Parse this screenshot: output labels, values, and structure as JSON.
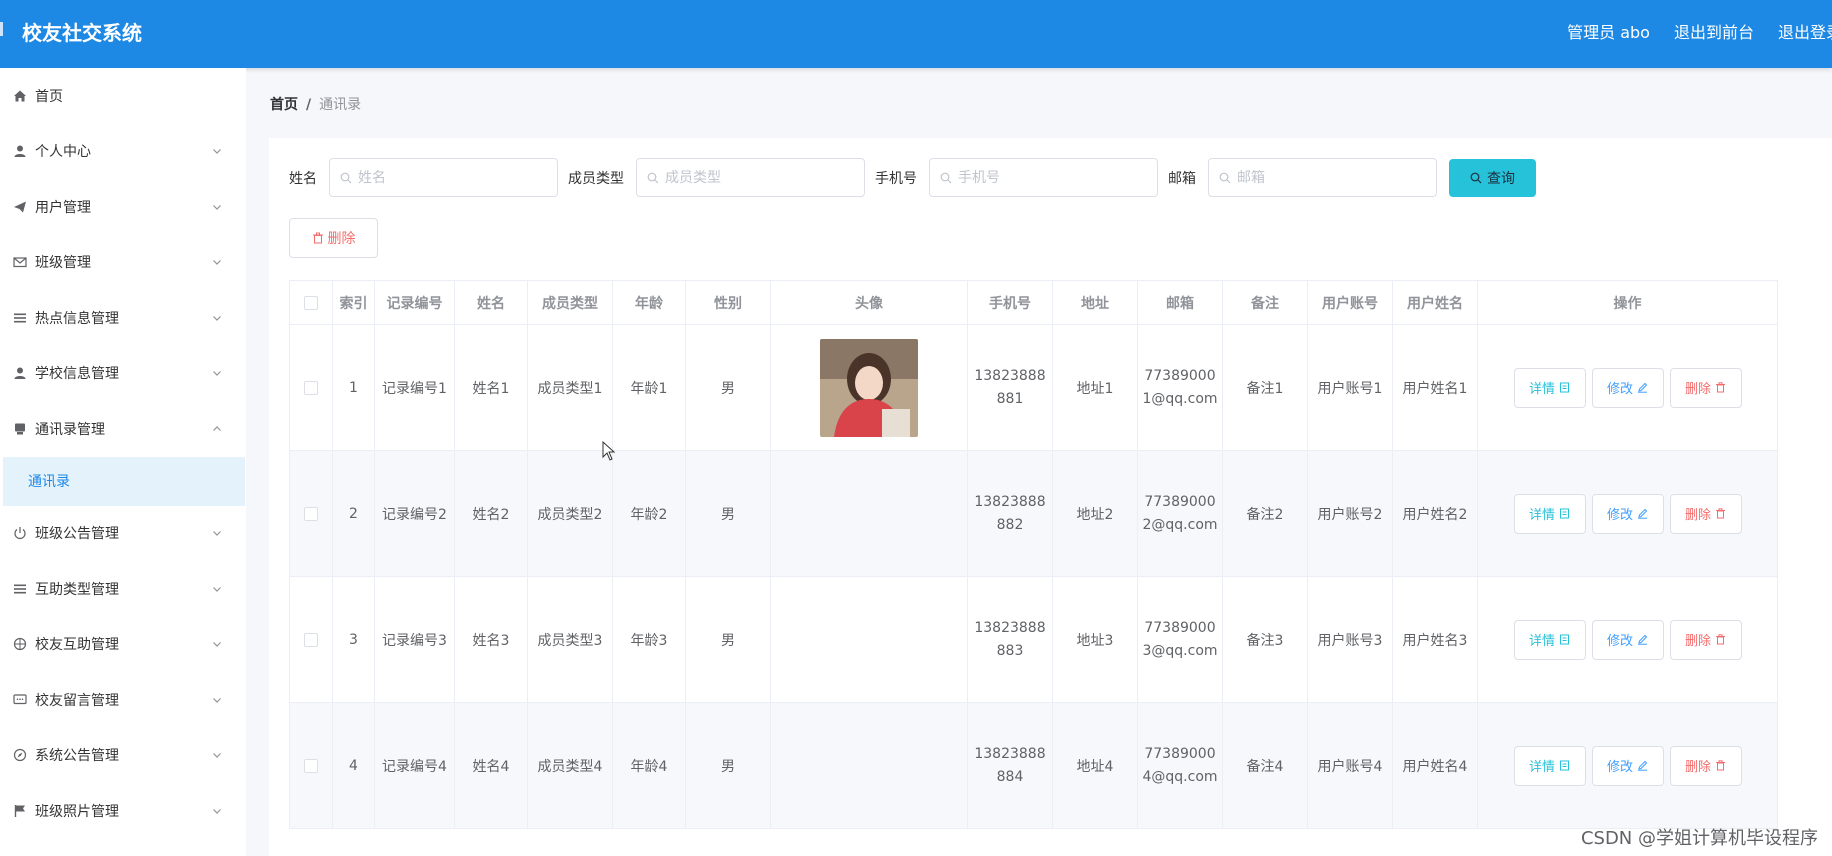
{
  "header": {
    "title": "校友社交系统",
    "user_label": "管理员 abo",
    "front_label": "退出到前台",
    "logout_label": "退出登录"
  },
  "sidebar": {
    "items": [
      {
        "label": "首页",
        "icon": "home-icon",
        "expandable": false
      },
      {
        "label": "个人中心",
        "icon": "user-icon",
        "expandable": true
      },
      {
        "label": "用户管理",
        "icon": "paper-plane-icon",
        "expandable": true
      },
      {
        "label": "班级管理",
        "icon": "mail-icon",
        "expandable": true
      },
      {
        "label": "热点信息管理",
        "icon": "list-icon",
        "expandable": true
      },
      {
        "label": "学校信息管理",
        "icon": "user-icon",
        "expandable": true
      },
      {
        "label": "通讯录管理",
        "icon": "bookmark-icon",
        "expandable": true,
        "expanded": true
      },
      {
        "label": "班级公告管理",
        "icon": "power-icon",
        "expandable": true
      },
      {
        "label": "互助类型管理",
        "icon": "list-icon",
        "expandable": true
      },
      {
        "label": "校友互助管理",
        "icon": "crosshair-icon",
        "expandable": true
      },
      {
        "label": "校友留言管理",
        "icon": "comment-icon",
        "expandable": true
      },
      {
        "label": "系统公告管理",
        "icon": "compass-icon",
        "expandable": true
      },
      {
        "label": "班级照片管理",
        "icon": "flag-icon",
        "expandable": true
      }
    ],
    "active_sub": "通讯录"
  },
  "breadcrumb": {
    "home": "首页",
    "separator": "/",
    "current": "通讯录"
  },
  "search": {
    "name_label": "姓名",
    "name_placeholder": "姓名",
    "type_label": "成员类型",
    "type_placeholder": "成员类型",
    "phone_label": "手机号",
    "phone_placeholder": "手机号",
    "email_label": "邮箱",
    "email_placeholder": "邮箱",
    "query_label": "查询"
  },
  "toolbar": {
    "delete_label": "删除"
  },
  "table": {
    "columns": [
      "索引",
      "记录编号",
      "姓名",
      "成员类型",
      "年龄",
      "性别",
      "头像",
      "手机号",
      "地址",
      "邮箱",
      "备注",
      "用户账号",
      "用户姓名",
      "操作"
    ],
    "rows": [
      {
        "index": "1",
        "record_no": "记录编号1",
        "name": "姓名1",
        "member_type": "成员类型1",
        "age": "年龄1",
        "gender": "男",
        "has_avatar": true,
        "phone": "13823888881",
        "address": "地址1",
        "email": "773890001@qq.com",
        "remark": "备注1",
        "account": "用户账号1",
        "user_name": "用户姓名1"
      },
      {
        "index": "2",
        "record_no": "记录编号2",
        "name": "姓名2",
        "member_type": "成员类型2",
        "age": "年龄2",
        "gender": "男",
        "has_avatar": false,
        "phone": "13823888882",
        "address": "地址2",
        "email": "773890002@qq.com",
        "remark": "备注2",
        "account": "用户账号2",
        "user_name": "用户姓名2"
      },
      {
        "index": "3",
        "record_no": "记录编号3",
        "name": "姓名3",
        "member_type": "成员类型3",
        "age": "年龄3",
        "gender": "男",
        "has_avatar": false,
        "phone": "13823888883",
        "address": "地址3",
        "email": "773890003@qq.com",
        "remark": "备注3",
        "account": "用户账号3",
        "user_name": "用户姓名3"
      },
      {
        "index": "4",
        "record_no": "记录编号4",
        "name": "姓名4",
        "member_type": "成员类型4",
        "age": "年龄4",
        "gender": "男",
        "has_avatar": false,
        "phone": "13823888884",
        "address": "地址4",
        "email": "773890004@qq.com",
        "remark": "备注4",
        "account": "用户账号4",
        "user_name": "用户姓名4"
      }
    ],
    "actions": {
      "detail": "详情",
      "edit": "修改",
      "delete": "删除"
    }
  },
  "watermark": "CSDN @学姐计算机毕设程序",
  "colors": {
    "header": "#1e88e5",
    "query_button": "#26c2d9",
    "danger": "#f56c6c",
    "active_sub_bg": "#e4f3fb"
  }
}
